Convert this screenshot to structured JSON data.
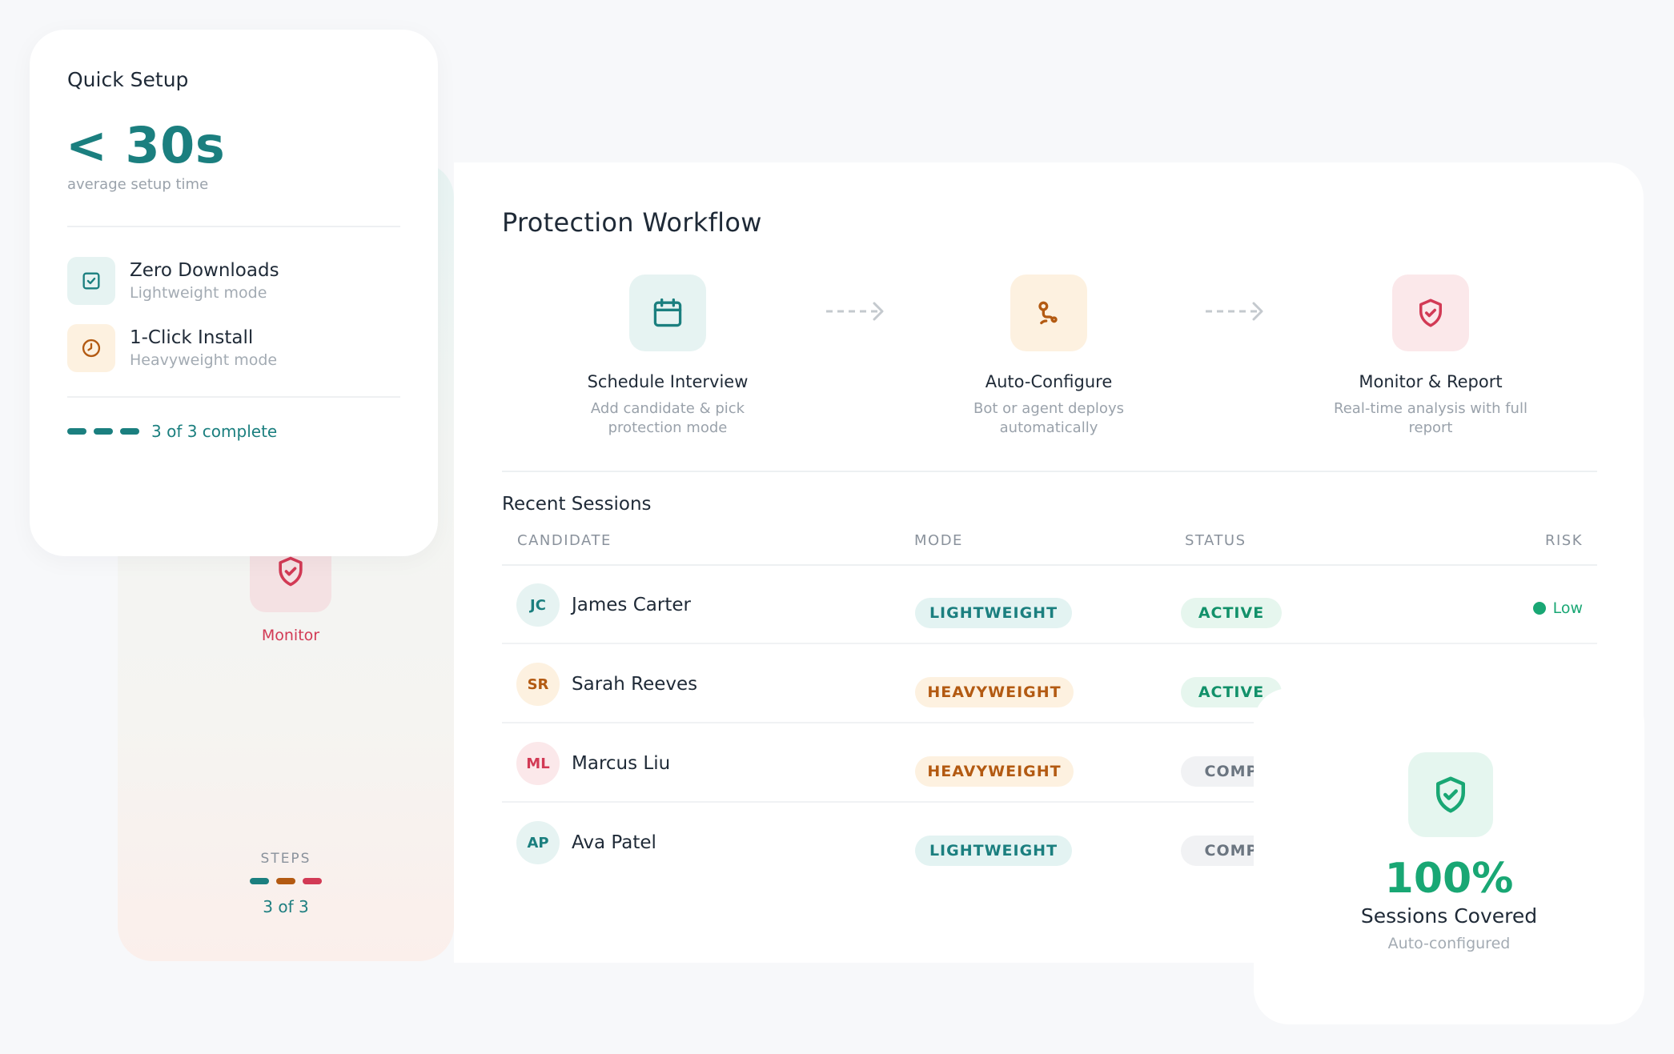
{
  "steps_panel": {
    "monitor_label": "Monitor",
    "steps_caption": "STEPS",
    "steps_count": "3 of 3",
    "bar_colors": [
      "#1b7f7f",
      "#b35a12",
      "#d23a55"
    ]
  },
  "quick_setup": {
    "title": "Quick Setup",
    "big_value": "< 30s",
    "big_caption": "average setup time",
    "items": [
      {
        "title": "Zero Downloads",
        "subtitle": "Lightweight mode",
        "icon": "checkbox-icon"
      },
      {
        "title": "1-Click Install",
        "subtitle": "Heavyweight mode",
        "icon": "clock-icon"
      }
    ],
    "progress_text": "3 of 3 complete"
  },
  "workflow": {
    "title": "Protection Workflow",
    "steps": [
      {
        "name": "Schedule Interview",
        "desc": "Add candidate & pick protection mode",
        "icon": "calendar-icon"
      },
      {
        "name": "Auto-Configure",
        "desc": "Bot or agent deploys automatically",
        "icon": "route-icon"
      },
      {
        "name": "Monitor & Report",
        "desc": "Real-time analysis with full report",
        "icon": "shield-check-icon"
      }
    ]
  },
  "sessions": {
    "title": "Recent Sessions",
    "headers": {
      "candidate": "CANDIDATE",
      "mode": "MODE",
      "status": "STATUS",
      "risk": "RISK"
    },
    "rows": [
      {
        "initials": "JC",
        "name": "James Carter",
        "mode": "LIGHTWEIGHT",
        "status": "ACTIVE",
        "risk": "Low"
      },
      {
        "initials": "SR",
        "name": "Sarah Reeves",
        "mode": "HEAVYWEIGHT",
        "status": "ACTIVE"
      },
      {
        "initials": "ML",
        "name": "Marcus Liu",
        "mode": "HEAVYWEIGHT",
        "status": "COMP"
      },
      {
        "initials": "AP",
        "name": "Ava Patel",
        "mode": "LIGHTWEIGHT",
        "status": "COMP"
      }
    ]
  },
  "coverage": {
    "value": "100%",
    "label": "Sessions Covered",
    "sublabel": "Auto-configured",
    "icon": "shield-check-icon"
  },
  "colors": {
    "teal": "#1b7f7f",
    "orange": "#b35a12",
    "red": "#d23a55",
    "green": "#19a774"
  }
}
